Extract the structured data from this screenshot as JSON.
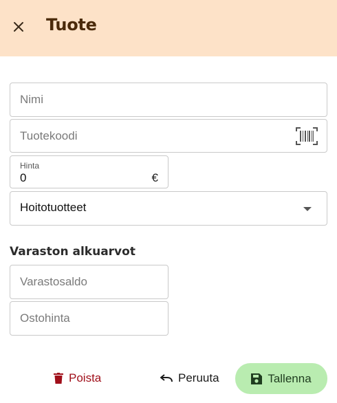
{
  "header": {
    "title": "Tuote",
    "close_icon": "close-icon",
    "background": "#fde2c8"
  },
  "form": {
    "name": {
      "value": "",
      "placeholder": "Nimi"
    },
    "product_code": {
      "value": "",
      "placeholder": "Tuotekoodi",
      "icon": "barcode-scan-icon"
    },
    "price": {
      "label": "Hinta",
      "value": "0",
      "currency": "€"
    },
    "category": {
      "selected": "Hoitotuotteet",
      "icon": "dropdown-arrow-icon"
    }
  },
  "inventory": {
    "section_title": "Varaston alkuarvot",
    "stock": {
      "value": "",
      "placeholder": "Varastosaldo"
    },
    "purchase_price": {
      "value": "",
      "placeholder": "Ostohinta"
    }
  },
  "actions": {
    "delete_label": "Poista",
    "cancel_label": "Peruuta",
    "save_label": "Tallenna",
    "delete_color": "#a00f1a",
    "save_bg": "#b9ecb0"
  }
}
